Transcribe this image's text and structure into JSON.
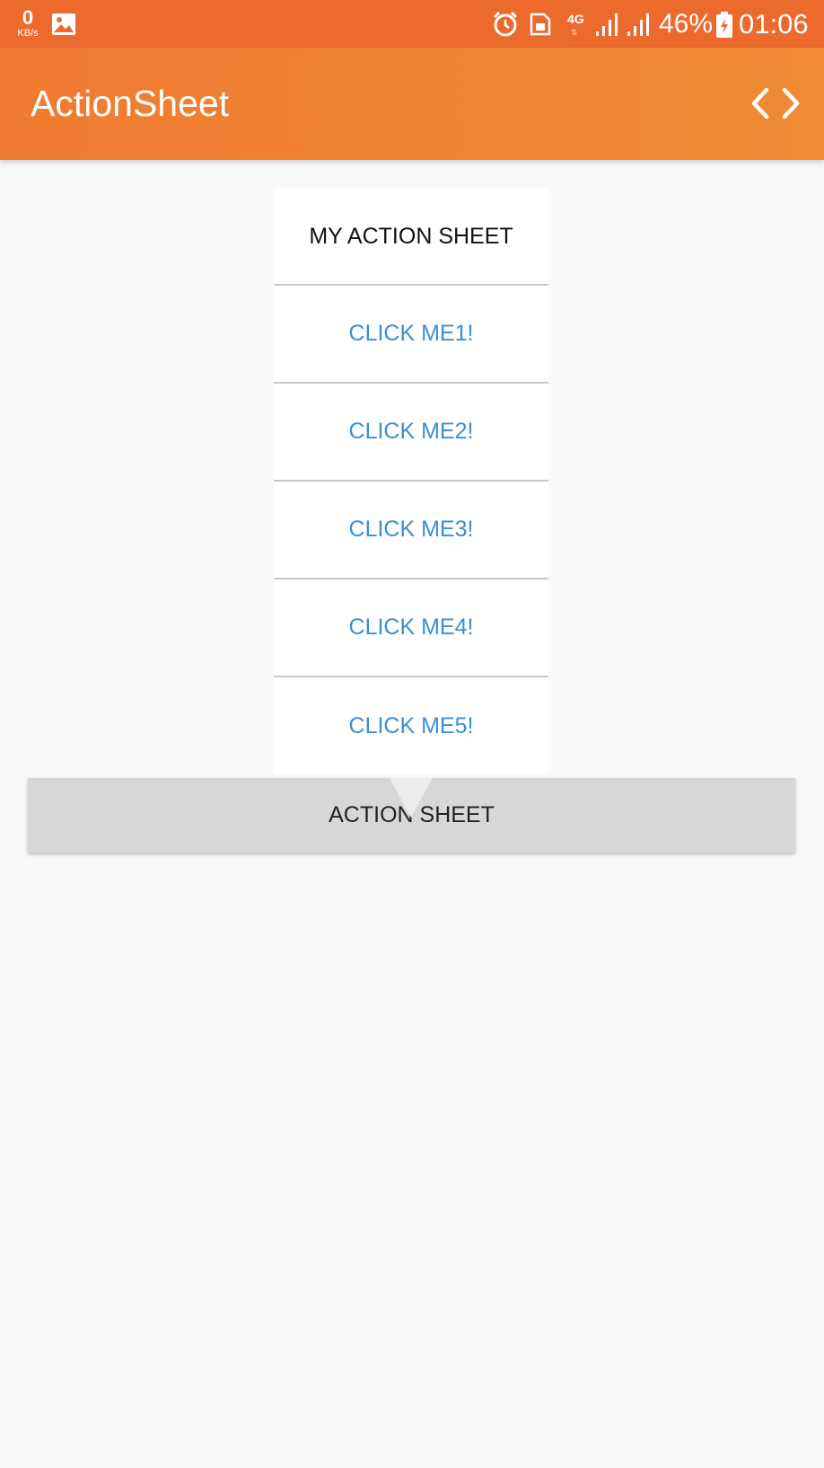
{
  "status_bar": {
    "data_rate": "0",
    "data_rate_unit": "KB/s",
    "network_type": "4G",
    "battery_percent": "46%",
    "time": "01:06",
    "icons": [
      "gallery-icon",
      "alarm-icon",
      "sim-icon",
      "signal-icon",
      "signal-icon",
      "battery-charging-icon"
    ]
  },
  "app_bar": {
    "title": "ActionSheet",
    "nav_icons": [
      "chevron-left-icon",
      "chevron-right-icon"
    ]
  },
  "action_sheet": {
    "title": "MY ACTION SHEET",
    "items": [
      "CLICK ME1!",
      "CLICK ME2!",
      "CLICK ME3!",
      "CLICK ME4!",
      "CLICK ME5!"
    ]
  },
  "main_button": {
    "label": "ACTION SHEET"
  },
  "colors": {
    "status_bar": "#ec6a2e",
    "app_bar": "#ef7b31",
    "item_text": "#3b8fd3",
    "button_bg": "#d6d7d7",
    "background": "#f9f9f9"
  }
}
